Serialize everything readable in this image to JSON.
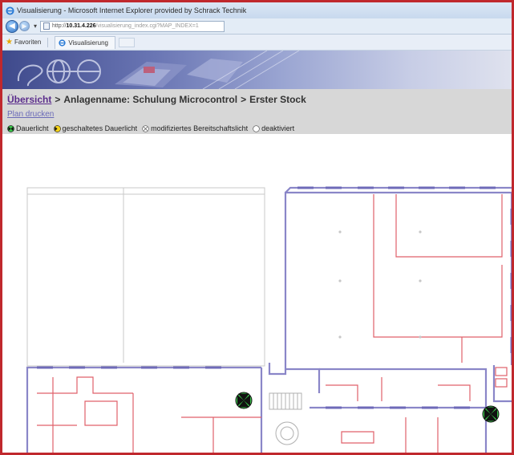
{
  "window": {
    "title": "Visualisierung - Microsoft Internet Explorer provided by Schrack Technik"
  },
  "address_bar": {
    "url_prefix": "http://",
    "url_host": "10.31.4.226",
    "url_path": "/visualisierung_index.cgi?MAP_INDEX=1"
  },
  "favorites_bar": {
    "favorites_label": "Favoriten",
    "tab_label": "Visualisierung"
  },
  "breadcrumb": {
    "overview": "Übersicht",
    "sep1": ">",
    "plant": "Anlagenname: Schulung Microcontrol",
    "sep2": ">",
    "floor": "Erster Stock"
  },
  "print_link": "Plan drucken",
  "legend": [
    {
      "label": "Dauerlicht",
      "icon": "permanent-light-icon"
    },
    {
      "label": "geschaltetes Dauerlicht",
      "icon": "switched-permanent-light-icon"
    },
    {
      "label": "modifiziertes Bereitschaftslicht",
      "icon": "modified-standby-light-icon"
    },
    {
      "label": "deaktiviert",
      "icon": "deactivated-icon"
    }
  ],
  "floor_plan": {
    "markers": [
      {
        "type": "Dauerlicht",
        "icon": "permanent-light-icon"
      },
      {
        "type": "Dauerlicht",
        "icon": "permanent-light-icon"
      }
    ]
  },
  "colors": {
    "window_border": "#c0282d",
    "breadcrumb_bg": "#d7d7d7",
    "link_visited": "#5b2d8c",
    "wall_blue": "#8a86c8",
    "wall_red": "#e0606a",
    "marker_green": "#39c24a"
  }
}
